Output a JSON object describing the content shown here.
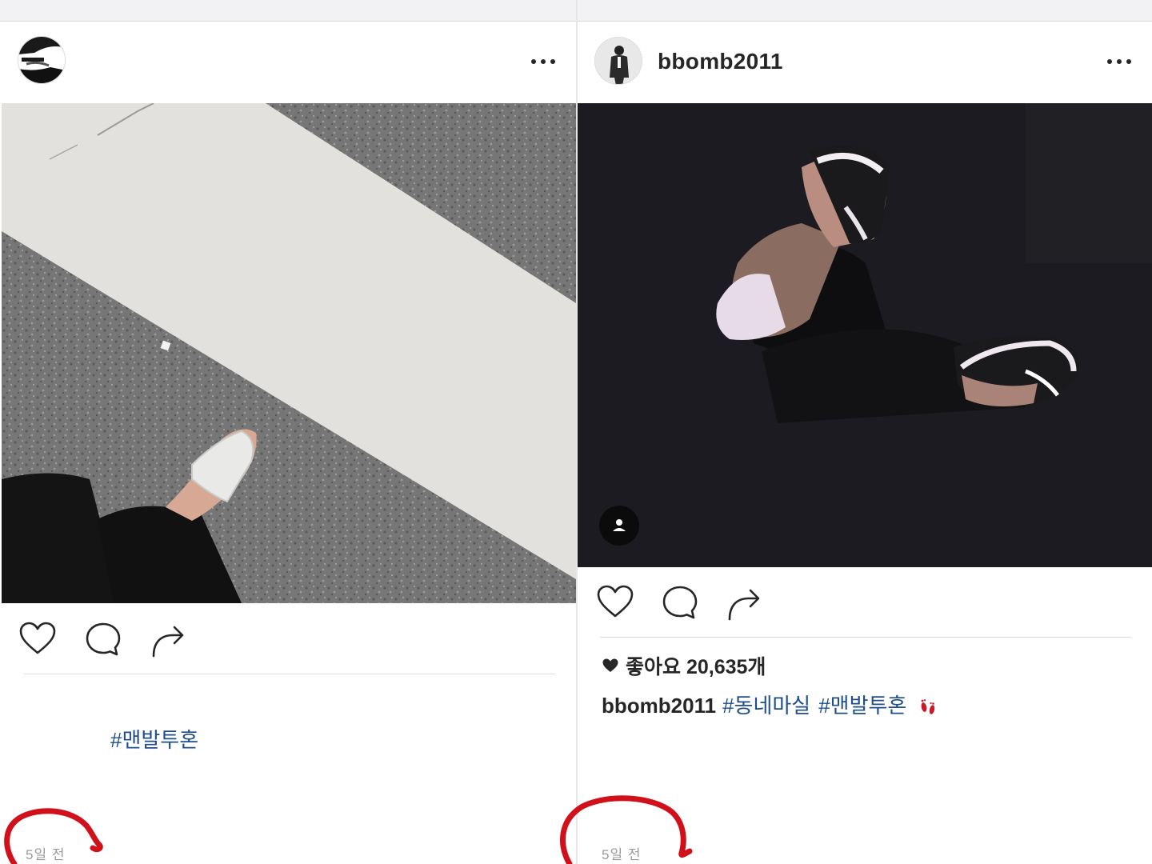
{
  "posts": [
    {
      "username": "",
      "hashtags": [
        "#맨발투혼"
      ],
      "timestamp": "5일 전"
    },
    {
      "username": "bbomb2011",
      "likes_text": "좋아요 20,635개",
      "caption_user": "bbomb2011",
      "hashtags": [
        "#동네마실",
        "#맨발투혼"
      ],
      "emoji_icon": "footprints-icon",
      "timestamp": "5일 전"
    }
  ],
  "icons": {
    "more": "more-options-icon",
    "like": "heart-icon",
    "comment": "comment-icon",
    "share": "share-icon",
    "tag": "user-tag-icon"
  },
  "colors": {
    "hashtag": "#1f4e8c",
    "annotation": "#d0101a",
    "timestamp": "#9a9a9a"
  }
}
